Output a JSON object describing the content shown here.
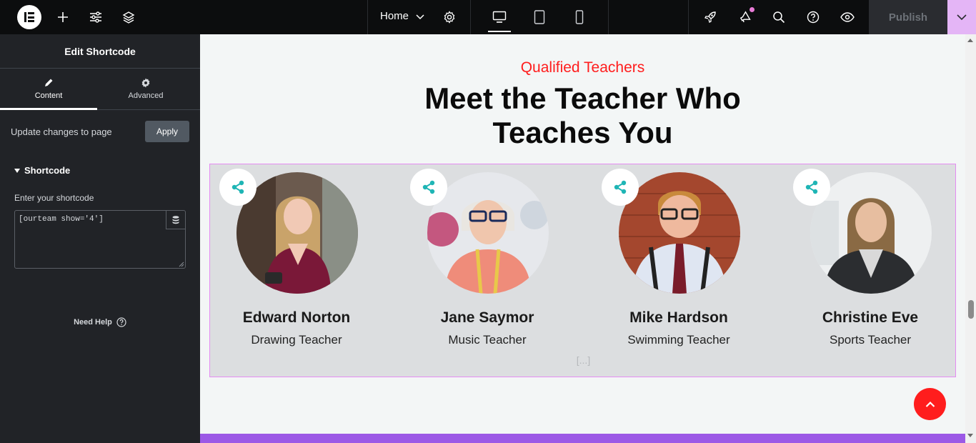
{
  "topbar": {
    "page_label": "Home",
    "publish_label": "Publish",
    "icons": [
      "elementor-logo-icon",
      "plus-icon",
      "sliders-icon",
      "layers-icon",
      "chevron-down-icon",
      "gear-icon",
      "desktop-icon",
      "tablet-icon",
      "mobile-icon",
      "rocket-icon",
      "megaphone-icon",
      "search-icon",
      "help-icon",
      "eye-icon"
    ],
    "accent_color": "#e4b5f6"
  },
  "panel": {
    "title": "Edit Shortcode",
    "tabs": [
      {
        "label": "Content",
        "icon": "pencil-icon"
      },
      {
        "label": "Advanced",
        "icon": "gear-icon"
      }
    ],
    "apply_label": "Update changes to page",
    "apply_button": "Apply",
    "section_title": "Shortcode",
    "field_label": "Enter your shortcode",
    "shortcode_value": "[ourteam show='4']",
    "need_help": "Need Help"
  },
  "canvas": {
    "eyebrow": "Qualified Teachers",
    "headline_line1": "Meet the Teacher Who",
    "headline_line2": "Teaches You",
    "ellipsis": "[...]",
    "eyebrow_color": "#ff1d1d",
    "team": [
      {
        "name": "Edward Norton",
        "role": "Drawing Teacher"
      },
      {
        "name": "Jane Saymor",
        "role": "Music Teacher"
      },
      {
        "name": "Mike Hardson",
        "role": "Swimming Teacher"
      },
      {
        "name": "Christine Eve",
        "role": "Sports Teacher"
      }
    ],
    "share_color": "#1fb5b5"
  }
}
